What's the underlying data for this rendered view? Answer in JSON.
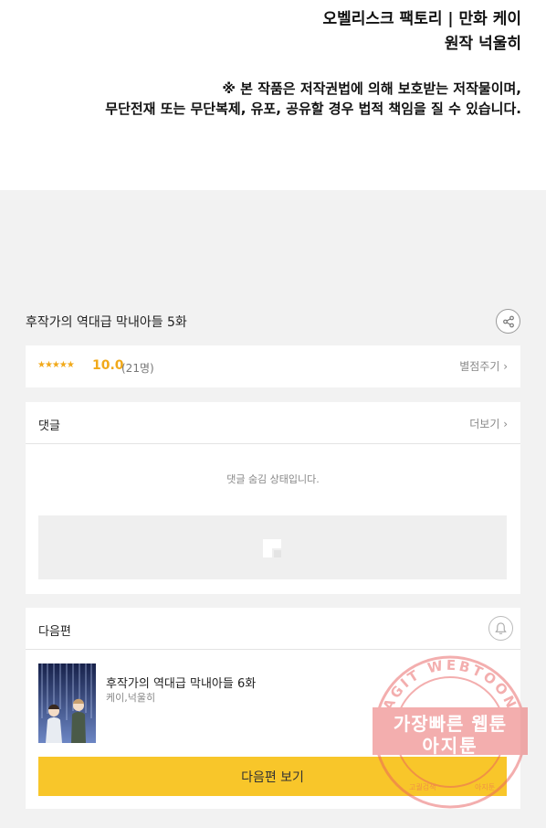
{
  "credits": {
    "line1": "오벨리스크 팩토리  | 만화 케이",
    "line2": "원작 넉울히"
  },
  "notice": {
    "line1": "※ 본 작품은 저작권법에 의해 보호받는 저작물이며,",
    "line2": "무단전재 또는 무단복제, 유포, 공유할 경우 법적 책임을 질 수 있습니다."
  },
  "episode": {
    "title": "후작가의 역대급 막내아들 5화",
    "share_icon": "share-icon"
  },
  "rating": {
    "stars": "★★★★★",
    "score": "10.0",
    "count": "(21명)",
    "rate_label": "별점주기 ›",
    "star_color": "#f1a91a"
  },
  "comments": {
    "title": "댓글",
    "more_label": "더보기 ›",
    "hidden_message": "댓글 숨김 상태입니다."
  },
  "next_episode": {
    "section_title": "다음편",
    "title": "후작가의 역대급 막내아들 6화",
    "author": "케이,넉울히",
    "button_label": "다음편 보기",
    "button_color": "#f8c62a",
    "bell_icon": "bell-icon"
  },
  "watermark": {
    "ring_text": "AGIT WEBTOON",
    "line1": "가장빠른 웹툰",
    "line2": "아지툰",
    "bottom_left": "고퀄검색",
    "bottom_right": "아지툰",
    "color": "#e95f5f"
  }
}
